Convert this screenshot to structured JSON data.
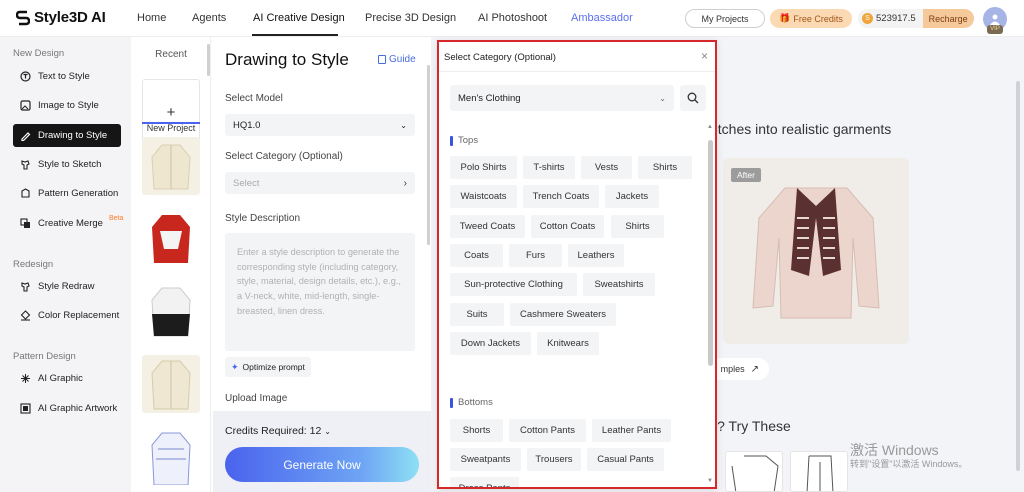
{
  "app": {
    "name": "Style3D AI"
  },
  "nav": {
    "items": [
      "Home",
      "Agents",
      "AI Creative Design",
      "Precise 3D Design",
      "AI Photoshoot",
      "Ambassador"
    ],
    "active": "AI Creative Design"
  },
  "header": {
    "my_projects": "My Projects",
    "free_credits": "Free Credits",
    "credits_value": "523917.5",
    "recharge": "Recharge",
    "vip": "VIP"
  },
  "sidebar": {
    "section_new": "New Design",
    "section_redesign": "Redesign",
    "section_pattern": "Pattern Design",
    "items": [
      {
        "label": "Text to Style",
        "icon": "text-style-icon"
      },
      {
        "label": "Image to Style",
        "icon": "image-style-icon"
      },
      {
        "label": "Drawing to Style",
        "icon": "drawing-style-icon",
        "active": true
      },
      {
        "label": "Style to Sketch",
        "icon": "sketch-icon"
      },
      {
        "label": "Pattern Generation",
        "icon": "pattern-gen-icon",
        "badge": "Beta"
      },
      {
        "label": "Creative Merge",
        "icon": "merge-icon"
      },
      {
        "label": "Style Redraw",
        "icon": "redraw-icon"
      },
      {
        "label": "Color Replacement",
        "icon": "color-replace-icon"
      },
      {
        "label": "AI Graphic",
        "icon": "graphic-icon"
      },
      {
        "label": "AI Graphic Artwork",
        "icon": "artwork-icon"
      }
    ]
  },
  "recent": {
    "title": "Recent",
    "new_project": "New Project"
  },
  "form": {
    "title": "Drawing to Style",
    "guide": "Guide",
    "model_label": "Select Model",
    "model_value": "HQ1.0",
    "category_label": "Select Category (Optional)",
    "category_placeholder": "Select",
    "description_label": "Style Description",
    "description_placeholder": "Enter a style description to generate the corresponding style (including category, style, material, design details, etc.), e.g., a V-neck, white, mid-length, single-breasted, linen dress.",
    "optimize": "Optimize prompt",
    "upload_label": "Upload Image",
    "credits_required": "Credits Required: 12",
    "generate": "Generate Now"
  },
  "main": {
    "hero_text": "etches into realistic garments",
    "after": "After",
    "examples": "mples",
    "try_text": "l? Try These",
    "watermark_1": "激活 Windows",
    "watermark_2": "转到\"设置\"以激活 Windows。"
  },
  "modal": {
    "title": "Select Category (Optional)",
    "selected": "Men's Clothing",
    "groups": [
      {
        "title": "Tops",
        "tags": [
          "Polo Shirts",
          "T-shirts",
          "Vests",
          "Shirts",
          "Waistcoats",
          "Trench Coats",
          "Jackets",
          "Tweed Coats",
          "Cotton Coats",
          "Shirts",
          "Coats",
          "Furs",
          "Leathers",
          "Sun-protective Clothing",
          "Sweatshirts",
          "Suits",
          "Cashmere Sweaters",
          "Down Jackets",
          "Knitwears"
        ]
      },
      {
        "title": "Bottoms",
        "tags": [
          "Shorts",
          "Cotton Pants",
          "Leather Pants",
          "Sweatpants",
          "Trousers",
          "Casual Pants",
          "Dress Pants"
        ]
      }
    ]
  },
  "colors": {
    "accent": "#4a63ee",
    "highlight_border": "#d62828",
    "ambassador": "#5b6ff3"
  }
}
